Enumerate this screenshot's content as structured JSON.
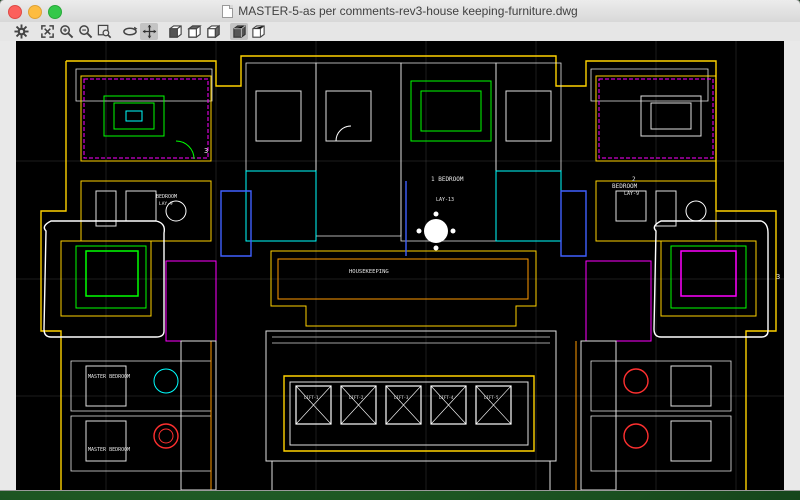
{
  "window": {
    "title": "MASTER-5-as per comments-rev3-house keeping-furniture.dwg"
  },
  "toolbar": {
    "buttons": [
      {
        "name": "settings-gear-icon"
      },
      {
        "name": "zoom-extents-icon"
      },
      {
        "name": "zoom-in-icon"
      },
      {
        "name": "zoom-out-icon"
      },
      {
        "name": "zoom-window-icon"
      },
      {
        "name": "orbit-icon"
      },
      {
        "name": "pan-icon"
      },
      {
        "name": "view-top-cube-icon"
      },
      {
        "name": "view-front-cube-icon"
      },
      {
        "name": "view-side-cube-icon"
      },
      {
        "name": "wireframe-view-icon"
      },
      {
        "name": "shaded-view-icon"
      }
    ]
  },
  "drawing": {
    "room_labels": {
      "bedroom_1": "1 BEDROOM",
      "lay_13": "LAY-13",
      "bedroom_left": "BEDROOM",
      "lay_9_left": "LAY-9",
      "bedroom_right": "BEDROOM",
      "lay_9_right": "LAY-9",
      "housekeeping": "HOUSEKEEPING",
      "master_bedroom_upper": "MASTER BEDROOM",
      "master_bedroom_lower": "MASTER BEDROOM",
      "num_2": "2",
      "num_3_left": "3",
      "num_3_right": "3",
      "lift_1": "LIFT-1",
      "lift_2": "LIFT-2",
      "lift_3": "LIFT-3",
      "lift_4": "LIFT-4",
      "lift_5": "LIFT-5"
    }
  }
}
